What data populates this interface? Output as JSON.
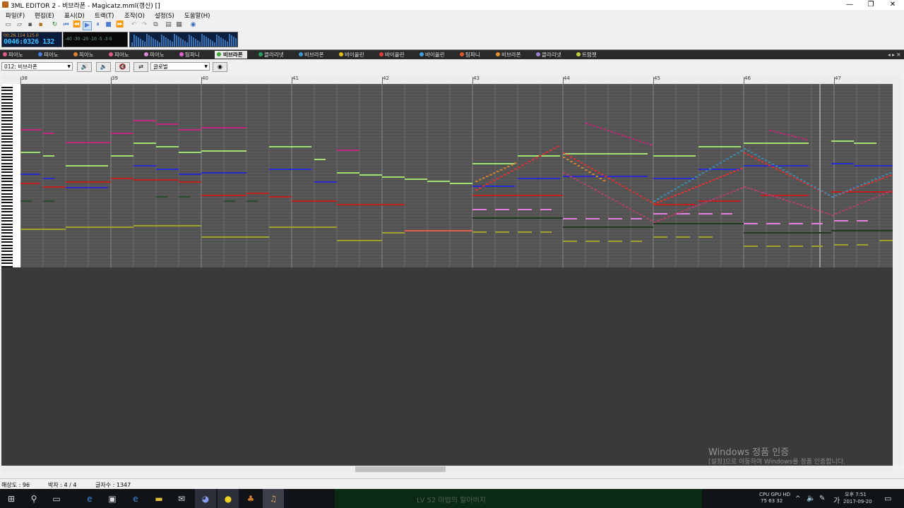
{
  "window": {
    "title": "3ML EDITOR 2 - 비브라폰 - Magicatz.mml(갱신) []",
    "min": "—",
    "max": "❐",
    "close": "✕"
  },
  "menu": [
    "파일(F)",
    "편집(E)",
    "표시(D)",
    "트랙(T)",
    "조작(O)",
    "설정(S)",
    "도움말(H)"
  ],
  "toolbar_icons": [
    "new-icon",
    "open-icon",
    "save-icon",
    "save-all-icon",
    "refresh-icon",
    "first-icon",
    "rewind-icon",
    "play-icon",
    "pause-icon",
    "stop-icon",
    "forward-icon",
    "undo-icon",
    "redo-icon",
    "copy-icon",
    "paste-icon",
    "settings-icon",
    "help-icon"
  ],
  "lcd": {
    "small": "00:26.114  125.0",
    "big": "0046:0326 132"
  },
  "meter": {
    "scale": "-40  -30  -20 -10  -5  -3  0"
  },
  "tabs": [
    {
      "label": "피아노",
      "color": "#e05a8a"
    },
    {
      "label": "피아노",
      "color": "#4a7be0"
    },
    {
      "label": "피아노",
      "color": "#e0802a"
    },
    {
      "label": "피아노",
      "color": "#e05a8a"
    },
    {
      "label": "피아노",
      "color": "#d88ad8"
    },
    {
      "label": "팀파니",
      "color": "#e060d0"
    },
    {
      "label": "비브라폰",
      "color": "#3aa83a",
      "active": true
    },
    {
      "label": "클라리넷",
      "color": "#2aa060"
    },
    {
      "label": "비브라폰",
      "color": "#3a9ad0"
    },
    {
      "label": "바이올린",
      "color": "#e0c020"
    },
    {
      "label": "바이올린",
      "color": "#e04040"
    },
    {
      "label": "바이올린",
      "color": "#40a0e0"
    },
    {
      "label": "팀파니",
      "color": "#e05a30"
    },
    {
      "label": "비브라폰",
      "color": "#e09030"
    },
    {
      "label": "클라리넷",
      "color": "#a080d0"
    },
    {
      "label": "트럼펫",
      "color": "#c0d040"
    }
  ],
  "track_select": "012: 비브라폰",
  "second_select": "글로벌",
  "bars": [
    "38",
    "39",
    "40",
    "41",
    "42",
    "43",
    "44",
    "45",
    "46",
    "47"
  ],
  "status": {
    "resolution": "해상도 : 96",
    "time_sig": "박자 : 4 / 4",
    "char_count": "글자수 : 1347"
  },
  "watermark": {
    "line1": "Windows 정품 인증",
    "line2": "[설정]으로 이동하여 Windows를 정품 인증합니다."
  },
  "taskbar": {
    "song": "LV 52 마법의 할아버지",
    "cpu_label": "CPU GPU HD",
    "cpu_values": "75  63  32",
    "ime": "가",
    "time": "오후 7:51",
    "date": "2017-09-20"
  }
}
